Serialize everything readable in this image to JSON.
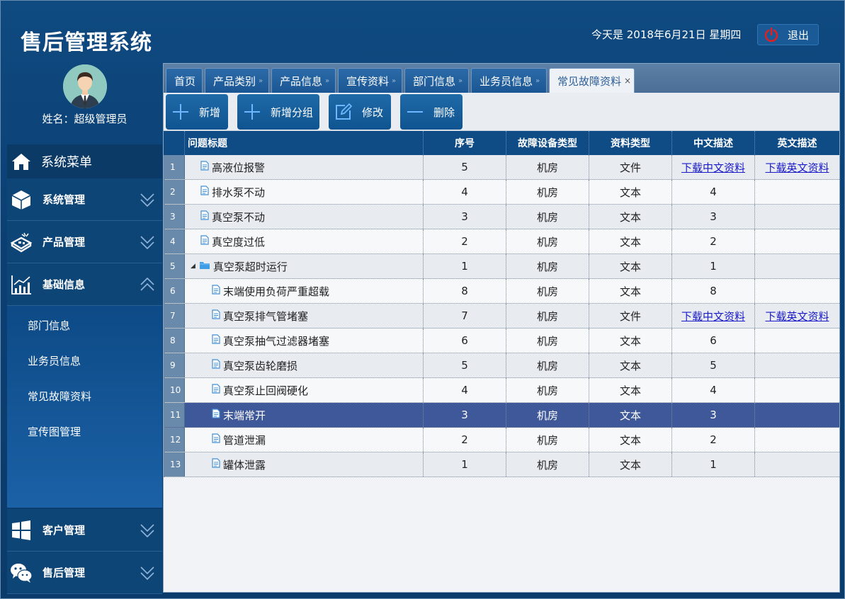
{
  "app": {
    "title": "售后管理系统",
    "date_text": "今天是 2018年6月21日 星期四",
    "logout_label": "退出"
  },
  "profile": {
    "name": "姓名：超级管理员"
  },
  "sidebar": {
    "menu_header": "系统菜单",
    "groups": [
      {
        "label": "系统管理",
        "icon": "cube-icon",
        "expanded": false
      },
      {
        "label": "产品管理",
        "icon": "product-icon",
        "expanded": false
      },
      {
        "label": "基础信息",
        "icon": "chart-icon",
        "expanded": true
      },
      {
        "label": "客户管理",
        "icon": "windows-icon",
        "expanded": false
      },
      {
        "label": "售后管理",
        "icon": "wechat-icon",
        "expanded": false
      }
    ],
    "submenu": [
      "部门信息",
      "业务员信息",
      "常见故障资料",
      "宣传图管理"
    ]
  },
  "tabs": [
    {
      "label": "首页",
      "closable": false
    },
    {
      "label": "产品类别",
      "closable": true
    },
    {
      "label": "产品信息",
      "closable": true
    },
    {
      "label": "宣传资料",
      "closable": true
    },
    {
      "label": "部门信息",
      "closable": true
    },
    {
      "label": "业务员信息",
      "closable": true
    },
    {
      "label": "常见故障资料",
      "closable": true,
      "active": true
    }
  ],
  "toolbar": {
    "add": "新增",
    "add_group": "新增分组",
    "edit": "修改",
    "delete": "删除"
  },
  "grid": {
    "columns": [
      "问题标题",
      "序号",
      "故障设备类型",
      "资料类型",
      "中文描述",
      "英文描述"
    ],
    "rows": [
      {
        "no": "1",
        "title": "高液位报警",
        "level": 0,
        "type": "file",
        "seq": "5",
        "device": "机房",
        "doc": "文件",
        "cn": "下载中文资料",
        "en": "下载英文资料",
        "cn_link": true,
        "en_link": true
      },
      {
        "no": "2",
        "title": "排水泵不动",
        "level": 0,
        "type": "file",
        "seq": "4",
        "device": "机房",
        "doc": "文本",
        "cn": "4",
        "en": ""
      },
      {
        "no": "3",
        "title": "真空泵不动",
        "level": 0,
        "type": "file",
        "seq": "3",
        "device": "机房",
        "doc": "文本",
        "cn": "3",
        "en": ""
      },
      {
        "no": "4",
        "title": "真空度过低",
        "level": 0,
        "type": "file",
        "seq": "2",
        "device": "机房",
        "doc": "文本",
        "cn": "2",
        "en": ""
      },
      {
        "no": "5",
        "title": "真空泵超时运行",
        "level": 0,
        "type": "folder",
        "seq": "1",
        "device": "机房",
        "doc": "文本",
        "cn": "1",
        "en": ""
      },
      {
        "no": "6",
        "title": "末端使用负荷严重超载",
        "level": 1,
        "type": "file",
        "seq": "8",
        "device": "机房",
        "doc": "文本",
        "cn": "8",
        "en": ""
      },
      {
        "no": "7",
        "title": "真空泵排气管堵塞",
        "level": 1,
        "type": "file",
        "seq": "7",
        "device": "机房",
        "doc": "文件",
        "cn": "下载中文资料",
        "en": "下载英文资料",
        "cn_link": true,
        "en_link": true
      },
      {
        "no": "8",
        "title": "真空泵抽气过滤器堵塞",
        "level": 1,
        "type": "file",
        "seq": "6",
        "device": "机房",
        "doc": "文本",
        "cn": "6",
        "en": ""
      },
      {
        "no": "9",
        "title": "真空泵齿轮磨损",
        "level": 1,
        "type": "file",
        "seq": "5",
        "device": "机房",
        "doc": "文本",
        "cn": "5",
        "en": ""
      },
      {
        "no": "10",
        "title": "真空泵止回阀硬化",
        "level": 1,
        "type": "file",
        "seq": "4",
        "device": "机房",
        "doc": "文本",
        "cn": "4",
        "en": ""
      },
      {
        "no": "11",
        "title": "末端常开",
        "level": 1,
        "type": "file",
        "seq": "3",
        "device": "机房",
        "doc": "文本",
        "cn": "3",
        "en": "",
        "selected": true
      },
      {
        "no": "12",
        "title": "管道泄漏",
        "level": 1,
        "type": "file",
        "seq": "2",
        "device": "机房",
        "doc": "文本",
        "cn": "2",
        "en": ""
      },
      {
        "no": "13",
        "title": "罐体泄露",
        "level": 1,
        "type": "file",
        "seq": "1",
        "device": "机房",
        "doc": "文本",
        "cn": "1",
        "en": ""
      }
    ]
  }
}
